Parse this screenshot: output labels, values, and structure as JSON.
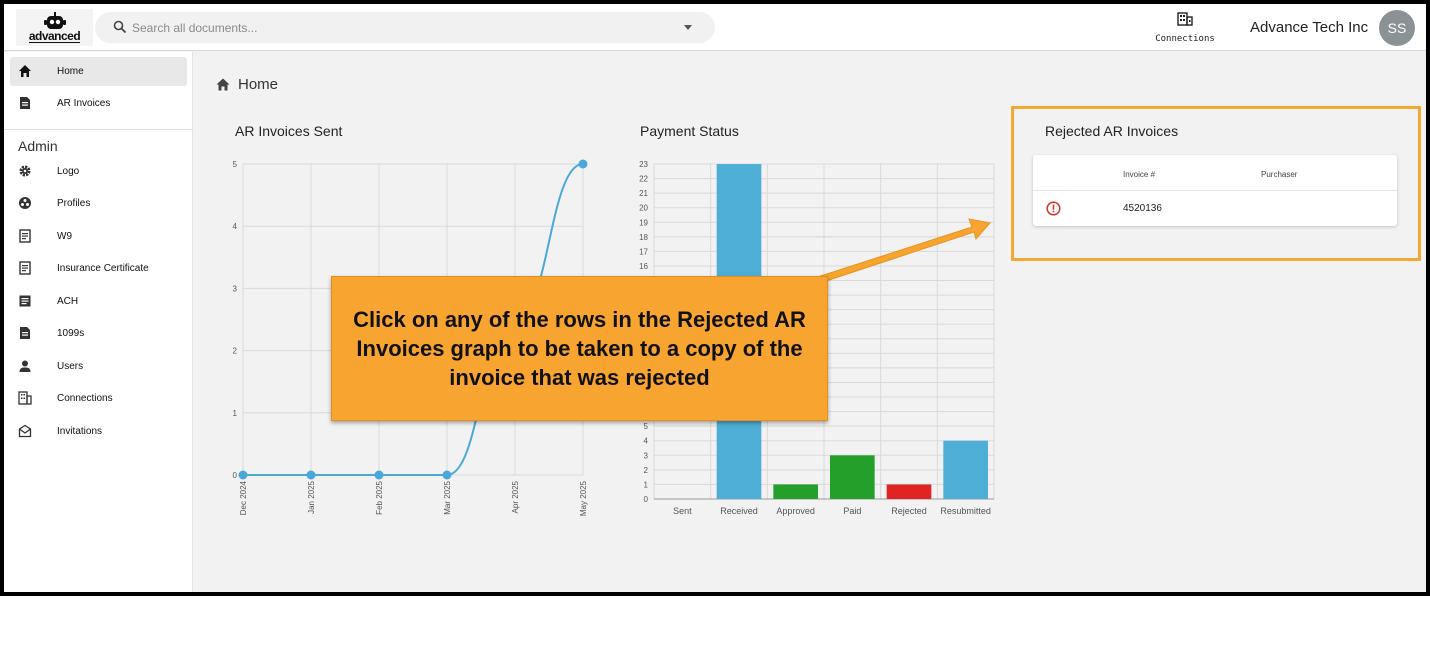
{
  "logo": {
    "text": "advanced"
  },
  "search": {
    "placeholder": "Search all documents..."
  },
  "header": {
    "connections_label": "Connections",
    "company": "Advance Tech Inc",
    "avatar_initials": "SS"
  },
  "sidebar": {
    "items": [
      {
        "label": "Home",
        "icon": "home-icon",
        "active": true
      },
      {
        "label": "AR Invoices",
        "icon": "document-icon"
      }
    ],
    "admin_heading": "Admin",
    "admin_items": [
      {
        "label": "Logo",
        "icon": "gear-icon"
      },
      {
        "label": "Profiles",
        "icon": "profiles-icon"
      },
      {
        "label": "W9",
        "icon": "form-icon"
      },
      {
        "label": "Insurance Certificate",
        "icon": "certificate-icon"
      },
      {
        "label": "ACH",
        "icon": "ach-icon"
      },
      {
        "label": "1099s",
        "icon": "document-icon"
      },
      {
        "label": "Users",
        "icon": "user-icon"
      },
      {
        "label": "Connections",
        "icon": "building-icon"
      },
      {
        "label": "Invitations",
        "icon": "mail-icon"
      }
    ]
  },
  "breadcrumb": {
    "title": "Home"
  },
  "charts": {
    "sent_title": "AR Invoices Sent",
    "payment_title": "Payment Status",
    "rejected_title": "Rejected AR Invoices"
  },
  "chart_data": [
    {
      "type": "line",
      "title": "AR Invoices Sent",
      "x": [
        "Dec 2024",
        "Jan 2025",
        "Feb 2025",
        "Mar 2025",
        "Apr 2025",
        "May 2025"
      ],
      "y": [
        0,
        0,
        0,
        0,
        2.5,
        5
      ],
      "ylim": [
        0,
        5
      ],
      "yticks": [
        0,
        1,
        2,
        3,
        4,
        5
      ],
      "color": "#4aa8d8"
    },
    {
      "type": "bar",
      "title": "Payment Status",
      "categories": [
        "Sent",
        "Received",
        "Approved",
        "Paid",
        "Rejected",
        "Resubmitted"
      ],
      "values": [
        0,
        23,
        1,
        3,
        1,
        4
      ],
      "colors": [
        "#4faed6",
        "#4faed6",
        "#24a02a",
        "#24a02a",
        "#e02424",
        "#4faed6"
      ],
      "ylim": [
        0,
        23
      ]
    }
  ],
  "rejected_table": {
    "headers": [
      "Invoice #",
      "Purchaser"
    ],
    "rows": [
      {
        "invoice": "4520136",
        "purchaser": "",
        "status": "error-icon"
      }
    ]
  },
  "callout": {
    "text": "Click on any of the rows in the Rejected AR Invoices graph to be taken to a copy of the invoice that was rejected"
  },
  "colors": {
    "accent_orange": "#f7a530",
    "line_blue": "#4aa8d8",
    "bar_green": "#24a02a",
    "bar_red": "#e02424"
  }
}
